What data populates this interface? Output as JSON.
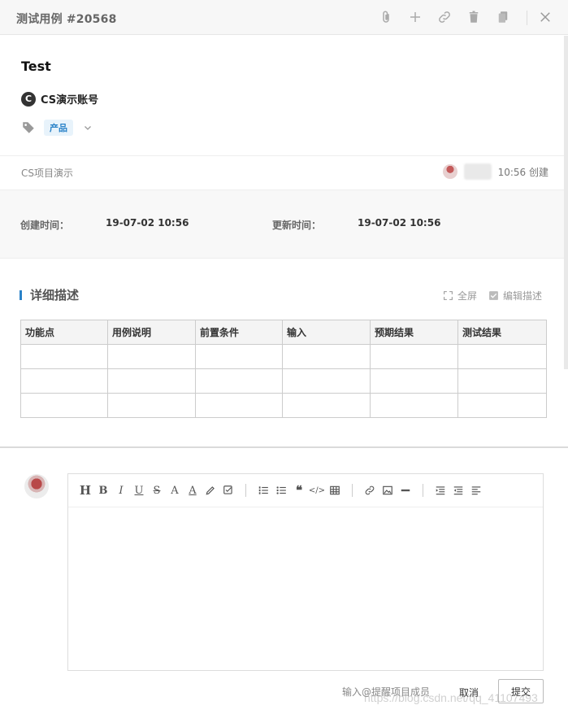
{
  "header": {
    "title": "测试用例 #20568",
    "icons": [
      "paperclip-icon",
      "plus-icon",
      "link-icon",
      "trash-icon",
      "copy-icon",
      "close-icon"
    ]
  },
  "case": {
    "title": "Test",
    "account_badge": "C",
    "account_name": "CS演示账号",
    "tag": "产品"
  },
  "meta": {
    "project": "CS项目演示",
    "created_label": "10:56 创建"
  },
  "times": {
    "created_label": "创建时间：",
    "created_value": "19-07-02 10:56",
    "updated_label": "更新时间：",
    "updated_value": "19-07-02 10:56"
  },
  "section": {
    "title": "详细描述",
    "fullscreen": "全屏",
    "edit": "编辑描述"
  },
  "table": {
    "headers": [
      "功能点",
      "用例说明",
      "前置条件",
      "输入",
      "预期结果",
      "测试结果"
    ],
    "empty_rows": 3
  },
  "comment": {
    "hint": "输入@提醒项目成员",
    "cancel": "取消",
    "submit": "提交"
  },
  "watermark": "https://blog.csdn.net/qq_41107493",
  "colors": {
    "accent": "#2a82c8",
    "tag_bg": "#e8f3fb"
  }
}
